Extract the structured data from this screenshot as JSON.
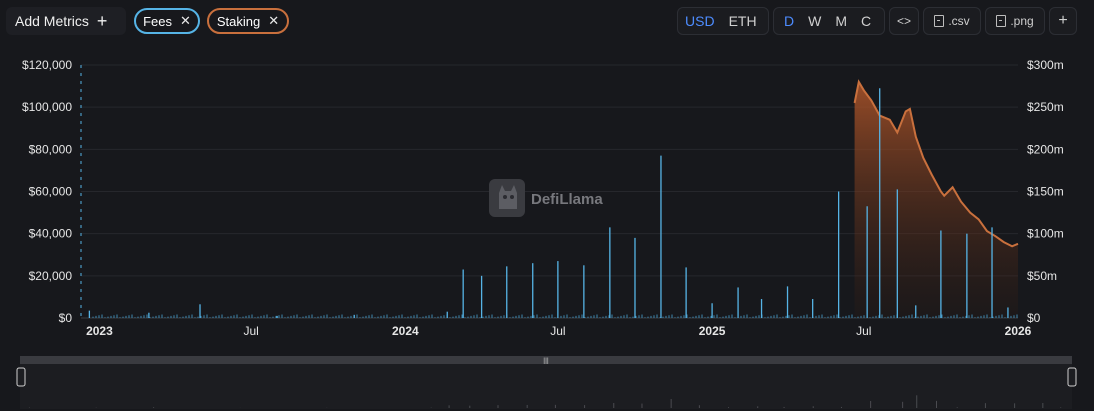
{
  "toolbar": {
    "add_metrics_label": "Add Metrics",
    "add_icon": "plus",
    "pills": [
      {
        "label": "Fees",
        "color": "#56b4e6"
      },
      {
        "label": "Staking",
        "color": "#c9703d"
      }
    ],
    "currency": {
      "options": [
        "USD",
        "ETH"
      ],
      "selected": "USD"
    },
    "granularity": {
      "options": [
        "D",
        "W",
        "M",
        "C"
      ],
      "selected": "D"
    },
    "embed_icon": "code-brackets",
    "csv_label": ".csv",
    "png_label": ".png",
    "expand_icon": "plus"
  },
  "watermark": "DefiLlama",
  "chart_data": {
    "type": "bar",
    "title": "",
    "x_tick_labels": [
      "2023",
      "Jul",
      "2024",
      "Jul",
      "2025",
      "Jul",
      "2026"
    ],
    "y_left": {
      "ticks": [
        "$0",
        "$20,000",
        "$40,000",
        "$60,000",
        "$80,000",
        "$100,000",
        "$120,000"
      ],
      "range": [
        0,
        120000
      ]
    },
    "y_right": {
      "ticks": [
        "$0",
        "$50m",
        "$100m",
        "$150m",
        "$200m",
        "$250m",
        "$300m"
      ],
      "range": [
        0,
        300000000
      ]
    },
    "grid": true,
    "series": [
      {
        "name": "Fees",
        "type": "bar",
        "color": "#56b4e6",
        "axis": "left",
        "points": [
          [
            "2022-12-20",
            3500
          ],
          [
            "2023-03-01",
            2500
          ],
          [
            "2023-05-01",
            6500
          ],
          [
            "2023-08-01",
            1000
          ],
          [
            "2023-11-01",
            1500
          ],
          [
            "2024-02-20",
            3000
          ],
          [
            "2024-03-10",
            23000
          ],
          [
            "2024-04-01",
            20000
          ],
          [
            "2024-05-01",
            24500
          ],
          [
            "2024-06-01",
            26000
          ],
          [
            "2024-07-01",
            27000
          ],
          [
            "2024-08-01",
            25000
          ],
          [
            "2024-09-01",
            43000
          ],
          [
            "2024-10-01",
            38000
          ],
          [
            "2024-11-01",
            77000
          ],
          [
            "2024-12-01",
            24000
          ],
          [
            "2025-01-01",
            7000
          ],
          [
            "2025-02-01",
            14500
          ],
          [
            "2025-03-01",
            9000
          ],
          [
            "2025-04-01",
            15000
          ],
          [
            "2025-05-01",
            9000
          ],
          [
            "2025-06-01",
            60000
          ],
          [
            "2025-07-05",
            53000
          ],
          [
            "2025-07-20",
            109000
          ],
          [
            "2025-08-10",
            61000
          ],
          [
            "2025-09-01",
            6000
          ],
          [
            "2025-10-01",
            41500
          ],
          [
            "2025-11-01",
            40000
          ],
          [
            "2025-12-01",
            43000
          ],
          [
            "2025-12-20",
            5000
          ]
        ]
      },
      {
        "name": "Staking",
        "type": "area",
        "color": "#c9703d",
        "axis": "right",
        "points": [
          [
            "2025-06-20",
            255000000
          ],
          [
            "2025-06-25",
            280000000
          ],
          [
            "2025-07-01",
            270000000
          ],
          [
            "2025-07-10",
            258000000
          ],
          [
            "2025-07-20",
            240000000
          ],
          [
            "2025-08-01",
            235000000
          ],
          [
            "2025-08-10",
            220000000
          ],
          [
            "2025-08-20",
            245000000
          ],
          [
            "2025-08-25",
            248000000
          ],
          [
            "2025-09-01",
            215000000
          ],
          [
            "2025-09-10",
            190000000
          ],
          [
            "2025-09-20",
            170000000
          ],
          [
            "2025-10-01",
            150000000
          ],
          [
            "2025-10-05",
            145000000
          ],
          [
            "2025-10-15",
            155000000
          ],
          [
            "2025-10-25",
            138000000
          ],
          [
            "2025-11-05",
            125000000
          ],
          [
            "2025-11-15",
            117000000
          ],
          [
            "2025-11-25",
            103000000
          ],
          [
            "2025-12-05",
            97000000
          ],
          [
            "2025-12-15",
            90000000
          ],
          [
            "2025-12-25",
            85000000
          ],
          [
            "2026-01-01",
            88000000
          ]
        ]
      }
    ]
  }
}
